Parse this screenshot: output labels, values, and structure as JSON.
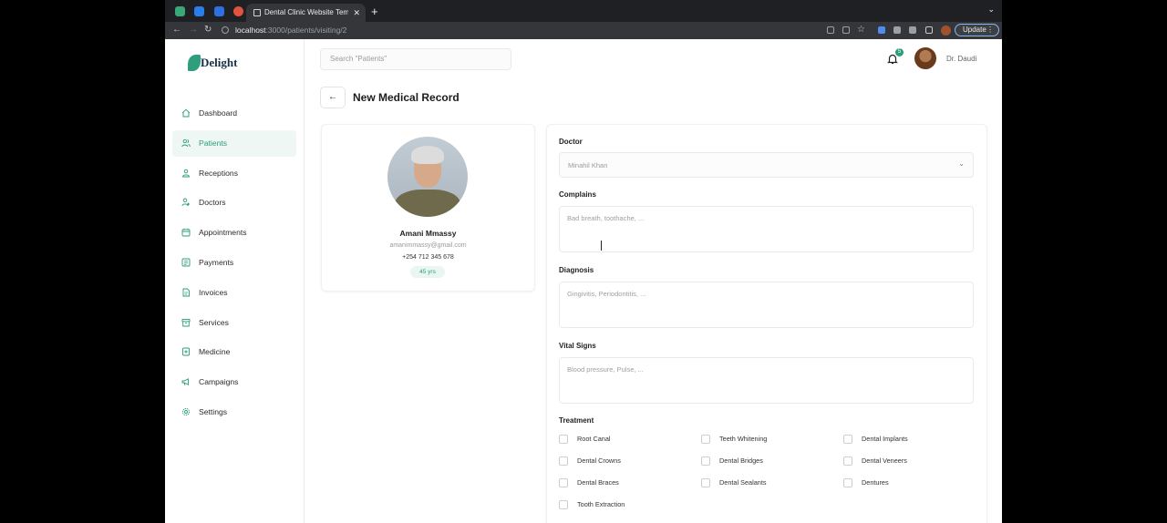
{
  "browser": {
    "tab_title": "Dental Clinic Website Templat",
    "url_host": "localhost",
    "url_path": ":3000/patients/visiting/2",
    "update_label": "Update"
  },
  "app": {
    "logo_text": "Delight",
    "search_placeholder": "Search \"Patients\"",
    "notification_count": "5",
    "user_name": "Dr. Daudi",
    "accent_color": "#2a9d7a"
  },
  "sidebar": {
    "items": [
      {
        "label": "Dashboard",
        "icon": "home-icon"
      },
      {
        "label": "Patients",
        "icon": "users-icon",
        "active": true
      },
      {
        "label": "Receptions",
        "icon": "user-group-icon"
      },
      {
        "label": "Doctors",
        "icon": "doctor-icon"
      },
      {
        "label": "Appointments",
        "icon": "calendar-icon"
      },
      {
        "label": "Payments",
        "icon": "credit-card-icon"
      },
      {
        "label": "Invoices",
        "icon": "invoice-icon"
      },
      {
        "label": "Services",
        "icon": "box-icon"
      },
      {
        "label": "Medicine",
        "icon": "medicine-icon"
      },
      {
        "label": "Campaigns",
        "icon": "megaphone-icon"
      },
      {
        "label": "Settings",
        "icon": "gear-icon"
      }
    ]
  },
  "page": {
    "title": "New Medical Record"
  },
  "patient": {
    "name": "Amani Mmassy",
    "email": "amanimmassy@gmail.com",
    "phone": "+254 712 345 678",
    "age": "45 yrs"
  },
  "form": {
    "doctor_label": "Doctor",
    "doctor_value": "Minahil Khan",
    "complains_label": "Complains",
    "complains_placeholder": "Bad breath, toothache, ...",
    "diagnosis_label": "Diagnosis",
    "diagnosis_placeholder": "Gingivitis, Periodontitis, ...",
    "vitals_label": "Vital Signs",
    "vitals_placeholder": "Blood pressure, Pulse, ...",
    "treatment_label": "Treatment",
    "treatments": [
      "Root Canal",
      "Teeth Whitening",
      "Dental Implants",
      "Dental Crowns",
      "Dental Bridges",
      "Dental Veneers",
      "Dental Braces",
      "Dental Sealants",
      "Dentures",
      "Tooth Extraction"
    ]
  }
}
